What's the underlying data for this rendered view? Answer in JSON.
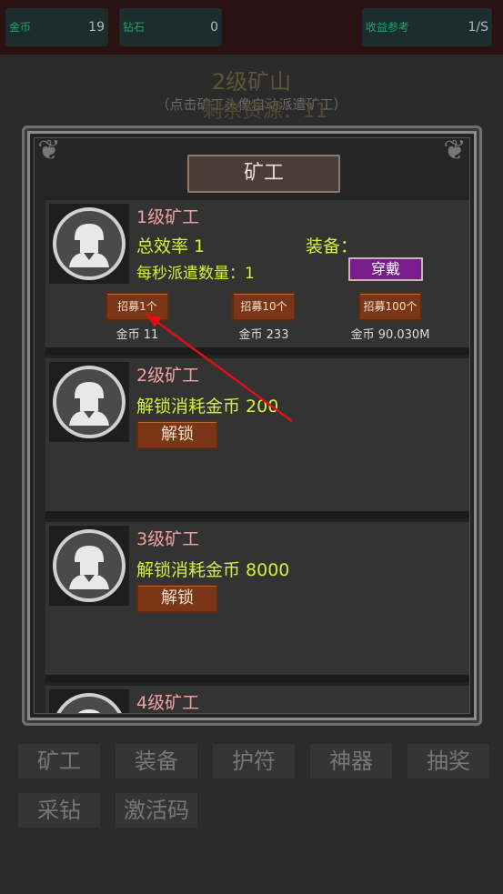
{
  "stats": {
    "gold": {
      "label": "金币",
      "value": "19"
    },
    "diamond": {
      "label": "钻石",
      "value": "0"
    },
    "income": {
      "label": "收益参考",
      "value": "1/S"
    }
  },
  "header": {
    "mine_title": "2级矿山",
    "hint": "（点击矿工头像自动派遣矿工）",
    "remaining": "剩余资源：11"
  },
  "panel": {
    "title": "矿工",
    "miners": [
      {
        "name": "1级矿工",
        "efficiency": "总效率 1",
        "dispatch": "每秒派遣数量：1",
        "equip_label": "装备：",
        "wear_label": "穿戴",
        "recruit": [
          {
            "label": "招募1个",
            "cost": "金币 11"
          },
          {
            "label": "招募10个",
            "cost": "金币 233"
          },
          {
            "label": "招募100个",
            "cost": "金币 90.030M"
          }
        ]
      },
      {
        "name": "2级矿工",
        "unlock_cost": "解锁消耗金币 200",
        "unlock_label": "解锁"
      },
      {
        "name": "3级矿工",
        "unlock_cost": "解锁消耗金币 8000",
        "unlock_label": "解锁"
      },
      {
        "name": "4级矿工"
      }
    ]
  },
  "nav": {
    "items": [
      "矿工",
      "装备",
      "护符",
      "神器",
      "抽奖",
      "采钻",
      "激活码"
    ]
  },
  "colors": {
    "accent_green": "#d6f038",
    "miner_name": "#f2a0a0",
    "button_brown": "#7b3618",
    "wear_purple": "#7a1c8c",
    "arrow_red": "#e01010"
  }
}
